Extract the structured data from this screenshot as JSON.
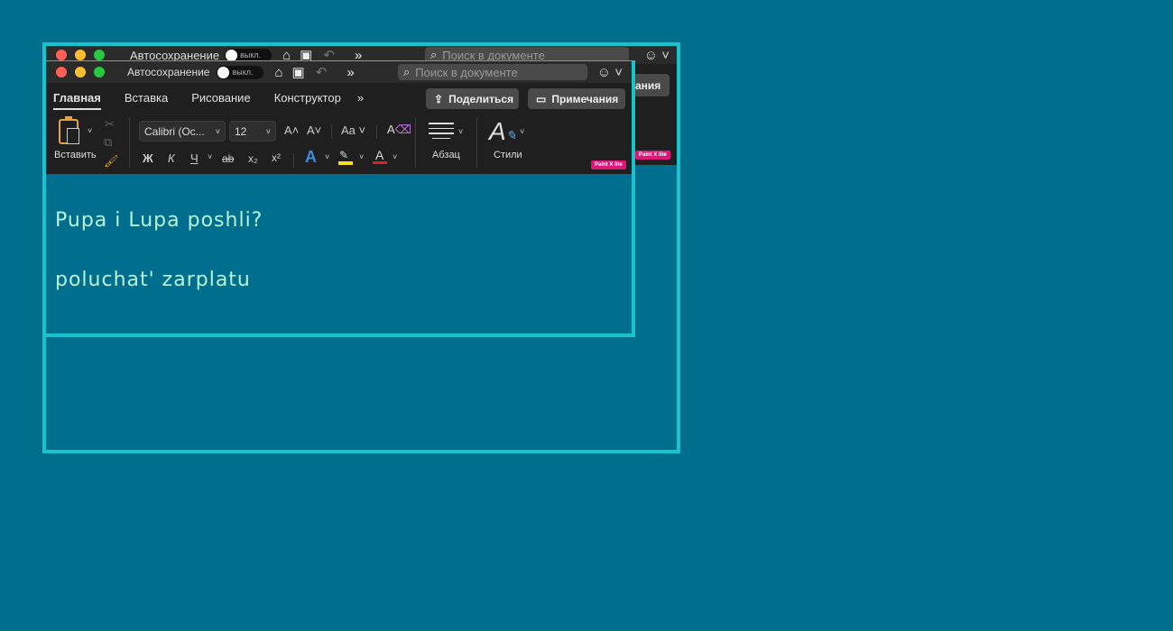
{
  "app": {
    "autosave_label": "Автосохранение",
    "autosave_state": "выкл.",
    "search_placeholder": "Поиск в документе"
  },
  "tabs": [
    "Главная",
    "Вставка",
    "Рисование",
    "Конструктор"
  ],
  "buttons": {
    "share": "Поделиться",
    "comments": "Примечания",
    "comments_partial": "ания"
  },
  "ribbon": {
    "paste_label": "Вставить",
    "font_name": "Calibri (Ос...",
    "font_size": "12",
    "paragraph_label": "Абзац",
    "styles_label": "Стили",
    "bold": "Ж",
    "italic": "К",
    "underline": "Ч",
    "strike": "ab",
    "subscript": "x₂",
    "superscript": "x²",
    "change_case": "Aa"
  },
  "badge": "Paint X lite",
  "document": {
    "line1": "Pupa i Lupa poshli?",
    "line2": "poluchat' zarplatu"
  },
  "colors": {
    "background": "#006e8f",
    "frame": "#17c4cc",
    "text": "#b7f3d4",
    "highlight": "#f5e11b",
    "font_color": "#e02020"
  }
}
